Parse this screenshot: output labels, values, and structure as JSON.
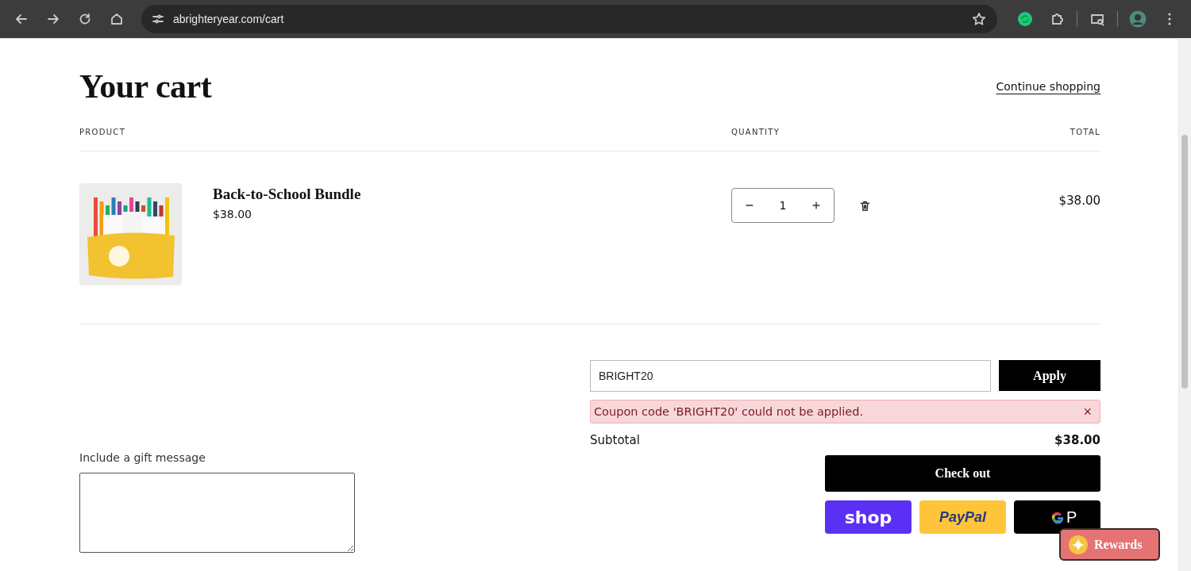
{
  "browser": {
    "url": "abrighteryear.com/cart"
  },
  "cart": {
    "title": "Your cart",
    "continue_link": "Continue shopping",
    "columns": [
      "PRODUCT",
      "QUANTITY",
      "TOTAL"
    ],
    "items": [
      {
        "kind": "picture",
        "name": "Back-to-School Bundle",
        "price": "$38.00",
        "quantity": "1",
        "total": "$38.00"
      }
    ]
  },
  "gift": {
    "label": "Include a gift message"
  },
  "coupon": {
    "value": "BRIGHT20",
    "button": "Apply",
    "error": "Coupon code 'BRIGHT20' could not be applied.",
    "dismiss": "×"
  },
  "subtotal": {
    "label": "Subtotal",
    "amount": "$38.00"
  },
  "checkout": {
    "button": "Check out"
  },
  "payments": [
    {
      "kind": "shop",
      "label": "shop"
    },
    {
      "kind": "paypal",
      "label": "PayPal"
    },
    {
      "kind": "gpay",
      "label": "P"
    }
  ],
  "rewards": {
    "label": "Rewards"
  }
}
